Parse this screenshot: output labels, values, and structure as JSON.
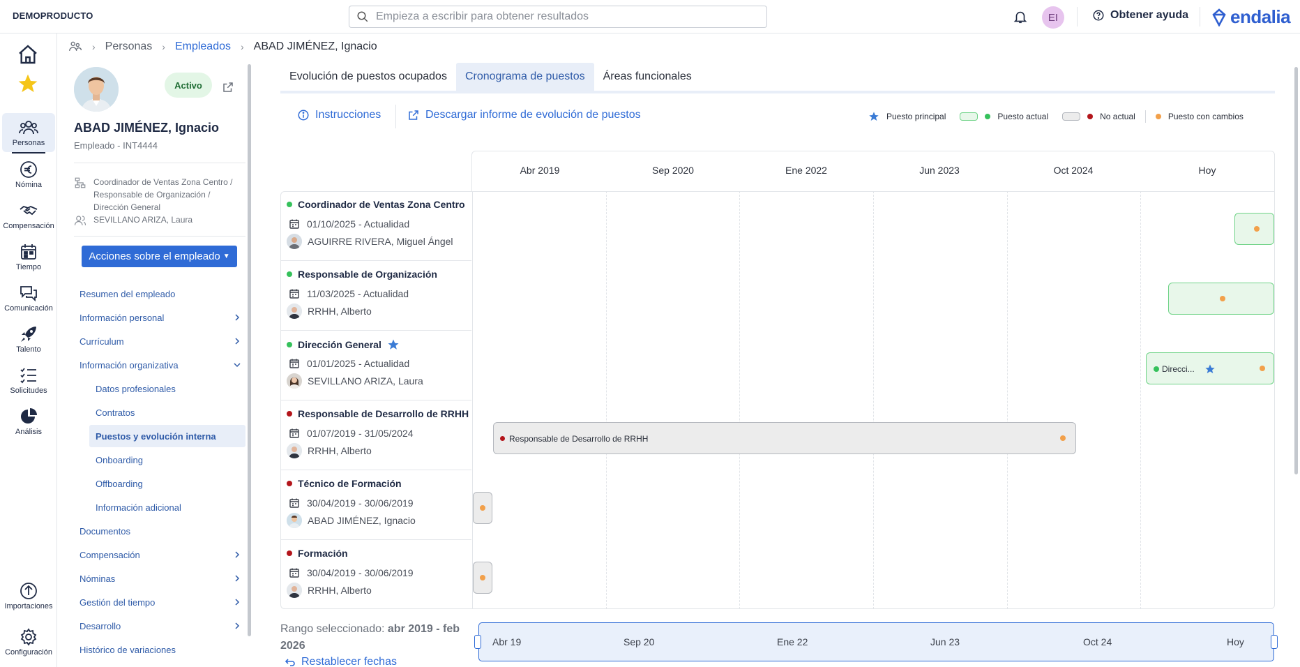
{
  "topbar": {
    "brand": "DEMOPRODUCTO",
    "search_placeholder": "Empieza a escribir para obtener resultados",
    "user_initials": "EI",
    "help_label": "Obtener ayuda",
    "logo_text": "endalia"
  },
  "rail": {
    "items": [
      {
        "label": "",
        "icon": "home-icon"
      },
      {
        "label": "",
        "icon": "star-icon"
      },
      {
        "label": "Personas",
        "icon": "people-icon"
      },
      {
        "label": "Nómina",
        "icon": "euro-icon"
      },
      {
        "label": "Compensación",
        "icon": "handshake-icon"
      },
      {
        "label": "Tiempo",
        "icon": "calendar-icon"
      },
      {
        "label": "Comunicación",
        "icon": "chat-icon"
      },
      {
        "label": "Talento",
        "icon": "rocket-icon"
      },
      {
        "label": "Solicitudes",
        "icon": "checklist-icon"
      },
      {
        "label": "Análisis",
        "icon": "pie-chart-icon"
      },
      {
        "label": "Importaciones",
        "icon": "upload-icon"
      },
      {
        "label": "Configuración",
        "icon": "gear-icon"
      }
    ]
  },
  "breadcrumb": {
    "items": [
      "Personas",
      "Empleados",
      "ABAD JIMÉNEZ, Ignacio"
    ]
  },
  "employee": {
    "status": "Activo",
    "name": "ABAD JIMÉNEZ, Ignacio",
    "code": "Empleado - INT4444",
    "org_path": [
      "Coordinador de Ventas Zona Centro /",
      "Responsable de Organización /",
      "Dirección General"
    ],
    "manager": "SEVILLANO ARIZA, Laura",
    "actions_label": "Acciones sobre el empleado"
  },
  "menu": {
    "items": [
      {
        "label": "Resumen del empleado"
      },
      {
        "label": "Información personal"
      },
      {
        "label": "Currículum"
      },
      {
        "label": "Información organizativa"
      },
      {
        "label": "Datos profesionales"
      },
      {
        "label": "Contratos"
      },
      {
        "label": "Puestos y evolución interna"
      },
      {
        "label": "Onboarding"
      },
      {
        "label": "Offboarding"
      },
      {
        "label": "Información adicional"
      },
      {
        "label": "Documentos"
      },
      {
        "label": "Compensación"
      },
      {
        "label": "Nóminas"
      },
      {
        "label": "Gestión del tiempo"
      },
      {
        "label": "Desarrollo"
      },
      {
        "label": "Histórico de variaciones"
      }
    ]
  },
  "tabs": [
    "Evolución de puestos ocupados",
    "Cronograma de puestos",
    "Áreas funcionales"
  ],
  "toolbar": {
    "instructions": "Instrucciones",
    "download": "Descargar informe de evolución de puestos"
  },
  "legend": {
    "main": "Puesto principal",
    "current": "Puesto actual",
    "not_current": "No actual",
    "changes": "Puesto con cambios"
  },
  "timeline": {
    "header": [
      "Abr 2019",
      "Sep 2020",
      "Ene 2022",
      "Jun 2023",
      "Oct 2024",
      "Hoy"
    ],
    "rows": [
      {
        "title": "Coordinador de Ventas Zona Centro",
        "dates": "01/10/2025 - Actualidad",
        "person": "AGUIRRE RIVERA, Miguel Ángel",
        "status": "current"
      },
      {
        "title": "Responsable de Organización",
        "dates": "11/03/2025 - Actualidad",
        "person": "RRHH, Alberto",
        "status": "current"
      },
      {
        "title": "Dirección General",
        "dates": "01/01/2025 - Actualidad",
        "person": "SEVILLANO ARIZA, Laura",
        "status": "current",
        "main": true,
        "bar_label": "Direcci..."
      },
      {
        "title": "Responsable de Desarrollo de RRHH",
        "dates": "01/07/2019 - 31/05/2024",
        "person": "RRHH, Alberto",
        "status": "past",
        "bar_label": "Responsable de Desarrollo de RRHH"
      },
      {
        "title": "Técnico de Formación",
        "dates": "30/04/2019 - 30/06/2019",
        "person": "ABAD JIMÉNEZ, Ignacio",
        "status": "past"
      },
      {
        "title": "Formación",
        "dates": "30/04/2019 - 30/06/2019",
        "person": "RRHH, Alberto",
        "status": "past"
      }
    ]
  },
  "range": {
    "prefix": "Rango seleccionado:",
    "value_1": "abr 2019 - feb",
    "value_2": "2026",
    "labels": [
      "Abr 19",
      "Sep 20",
      "Ene 22",
      "Jun 23",
      "Oct 24",
      "Hoy"
    ],
    "reset": "Restablecer fechas"
  },
  "colors": {
    "accent": "#2f6bd6",
    "current_green": "#35c15b",
    "past_red": "#b3151b",
    "changes_orange": "#f2a04a"
  }
}
